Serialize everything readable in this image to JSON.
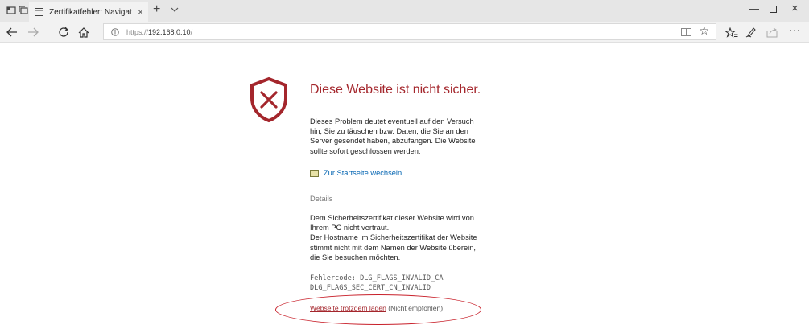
{
  "window": {
    "tab_title": "Zertifikatfehler: Navigat",
    "tab_close": "×",
    "new_tab": "+",
    "minimize": "—",
    "maximize": "▫",
    "close": "×"
  },
  "address_bar": {
    "url_prefix": "https://",
    "url_host": "192.168.0.10",
    "url_suffix": "/"
  },
  "icons": {
    "back": "back-arrow-icon",
    "forward": "forward-arrow-icon",
    "refresh": "refresh-icon",
    "home": "home-icon",
    "favorites": "favorites-icon",
    "pen": "pen-icon",
    "share": "share-icon",
    "more": "more-icon"
  },
  "page": {
    "heading": "Diese Website ist nicht sicher.",
    "description_lines": [
      "Dieses Problem deutet eventuell auf den Versuch",
      "hin, Sie zu täuschen bzw. Daten, die Sie an den",
      "Server gesendet haben, abzufangen. Die Website",
      "sollte sofort geschlossen werden."
    ],
    "start_link": "Zur Startseite wechseln",
    "details_label": "Details",
    "details_lines": [
      "Dem Sicherheitszertifikat dieser Website wird von",
      "Ihrem PC nicht vertraut.",
      "Der Hostname im Sicherheitszertifikat der Website",
      "stimmt nicht mit dem Namen der Website überein,",
      "die Sie besuchen möchten."
    ],
    "error_code_lines": [
      "Fehlercode: DLG_FLAGS_INVALID_CA",
      "DLG_FLAGS_SEC_CERT_CN_INVALID"
    ],
    "proceed_link": "Webseite trotzdem laden",
    "proceed_note": " (Nicht empfohlen)"
  },
  "colors": {
    "warning_red": "#a4262c",
    "link_blue": "#0063b1",
    "annotation_red": "#c8202a"
  }
}
